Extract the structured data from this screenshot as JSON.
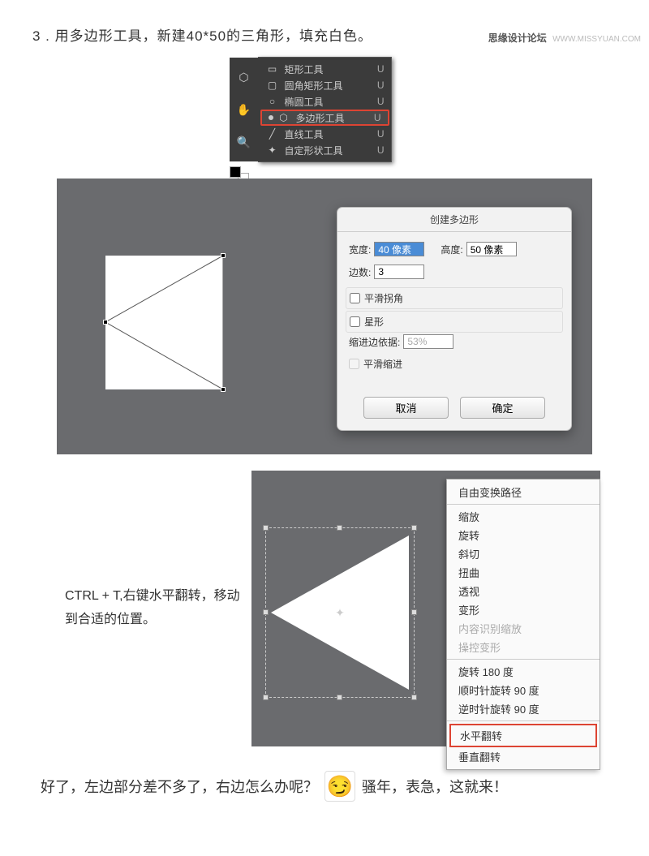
{
  "watermark": {
    "cn": "思缘设计论坛",
    "en": "WWW.MISSYUAN.COM"
  },
  "step3": "3 . 用多边形工具，新建40*50的三角形，填充白色。",
  "toolMenu": {
    "items": [
      {
        "label": "矩形工具",
        "shortcut": "U"
      },
      {
        "label": "圆角矩形工具",
        "shortcut": "U"
      },
      {
        "label": "椭圆工具",
        "shortcut": "U"
      },
      {
        "label": "多边形工具",
        "shortcut": "U"
      },
      {
        "label": "直线工具",
        "shortcut": "U"
      },
      {
        "label": "自定形状工具",
        "shortcut": "U"
      }
    ]
  },
  "createPolygon": {
    "title": "创建多边形",
    "widthLabel": "宽度:",
    "widthValue": "40 像素",
    "heightLabel": "高度:",
    "heightValue": "50 像素",
    "sidesLabel": "边数:",
    "sidesValue": "3",
    "smoothCorners": "平滑拐角",
    "star": "星形",
    "indentLabel": "缩进边依据:",
    "indentValue": "53%",
    "smoothIndent": "平滑缩进",
    "cancel": "取消",
    "ok": "确定"
  },
  "transformNote": "CTRL + T,右键水平翻转，移动到合适的位置。",
  "contextMenu": {
    "title": "自由变换路径",
    "items1": [
      "缩放",
      "旋转",
      "斜切",
      "扭曲",
      "透视",
      "变形"
    ],
    "disabled": [
      "内容识别缩放",
      "操控变形"
    ],
    "items2": [
      "旋转 180 度",
      "顺时针旋转 90 度",
      "逆时针旋转 90 度"
    ],
    "highlighted": "水平翻转",
    "last": "垂直翻转"
  },
  "bottom": {
    "left": "好了，左边部分差不多了，右边怎么办呢？",
    "right": "骚年，表急，这就来！"
  }
}
